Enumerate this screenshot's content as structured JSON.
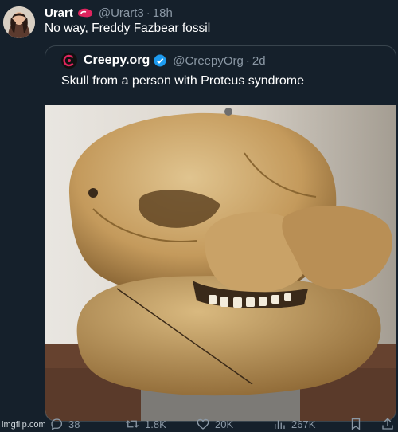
{
  "tweet": {
    "author_name": "Urart",
    "handle": "@Urart3",
    "separator": "·",
    "time": "18h",
    "text": "No way, Freddy Fazbear fossil"
  },
  "quote": {
    "author_name": "Creepy.org",
    "handle": "@CreepyOrg",
    "separator": "·",
    "time": "2d",
    "text": "Skull from a person with Proteus syndrome"
  },
  "actions": {
    "replies": "38",
    "retweets": "1.8K",
    "likes": "20K",
    "views": "267K"
  },
  "watermark": "imgflip.com",
  "colors": {
    "background": "#15202b",
    "text_secondary": "#8b98a5",
    "border": "#38444d",
    "verified_blue": "#1d9bf0",
    "badge_red": "#e0245e"
  }
}
